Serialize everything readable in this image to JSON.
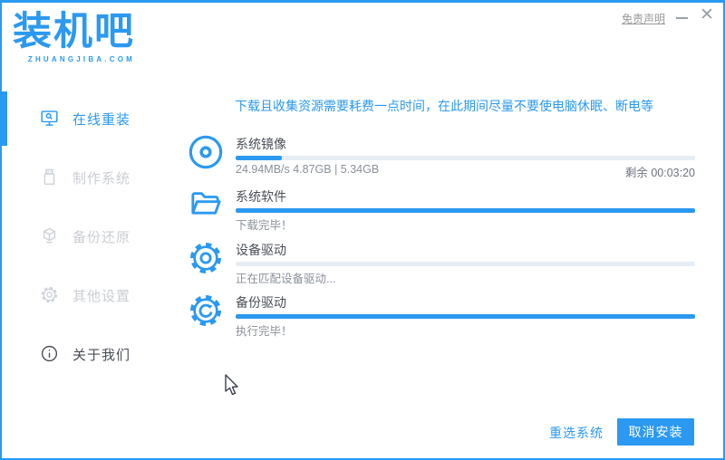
{
  "header": {
    "logo_title": "装机吧",
    "logo_subtitle": "ZHUANGJIBA.COM",
    "disclaimer_link": "免责声明",
    "close_glyph": "✕"
  },
  "sidebar": {
    "items": [
      {
        "label": "在线重装",
        "icon": "monitor-search-icon",
        "active": true
      },
      {
        "label": "制作系统",
        "icon": "usb-drive-icon",
        "active": false
      },
      {
        "label": "备份还原",
        "icon": "backup-box-icon",
        "active": false
      },
      {
        "label": "其他设置",
        "icon": "gear-icon",
        "active": false
      },
      {
        "label": "关于我们",
        "icon": "info-icon",
        "active": false
      }
    ]
  },
  "main": {
    "notice": "下载且收集资源需要耗费一点时间，在此期间尽量不要使电脑休眠、断电等",
    "tasks": [
      {
        "name": "系统镜像",
        "icon": "disc-icon",
        "progress_percent": 10,
        "status_left": "24.94MB/s 4.87GB | 5.34GB",
        "status_right": "剩余 00:03:20"
      },
      {
        "name": "系统软件",
        "icon": "open-folder-icon",
        "progress_percent": 100,
        "status_left": "下载完毕！",
        "status_right": ""
      },
      {
        "name": "设备驱动",
        "icon": "gear-icon",
        "progress_percent": 0,
        "status_left": "正在匹配设备驱动...",
        "status_right": ""
      },
      {
        "name": "备份驱动",
        "icon": "sync-gear-icon",
        "progress_percent": 100,
        "status_left": "执行完毕！",
        "status_right": ""
      }
    ]
  },
  "footer": {
    "reselect_label": "重选系统",
    "cancel_label": "取消安装"
  },
  "colors": {
    "primary": "#2b99f1",
    "progress_track": "#e7edf4",
    "inactive_gray": "#c9cdd3",
    "status_gray": "#8a9099"
  }
}
